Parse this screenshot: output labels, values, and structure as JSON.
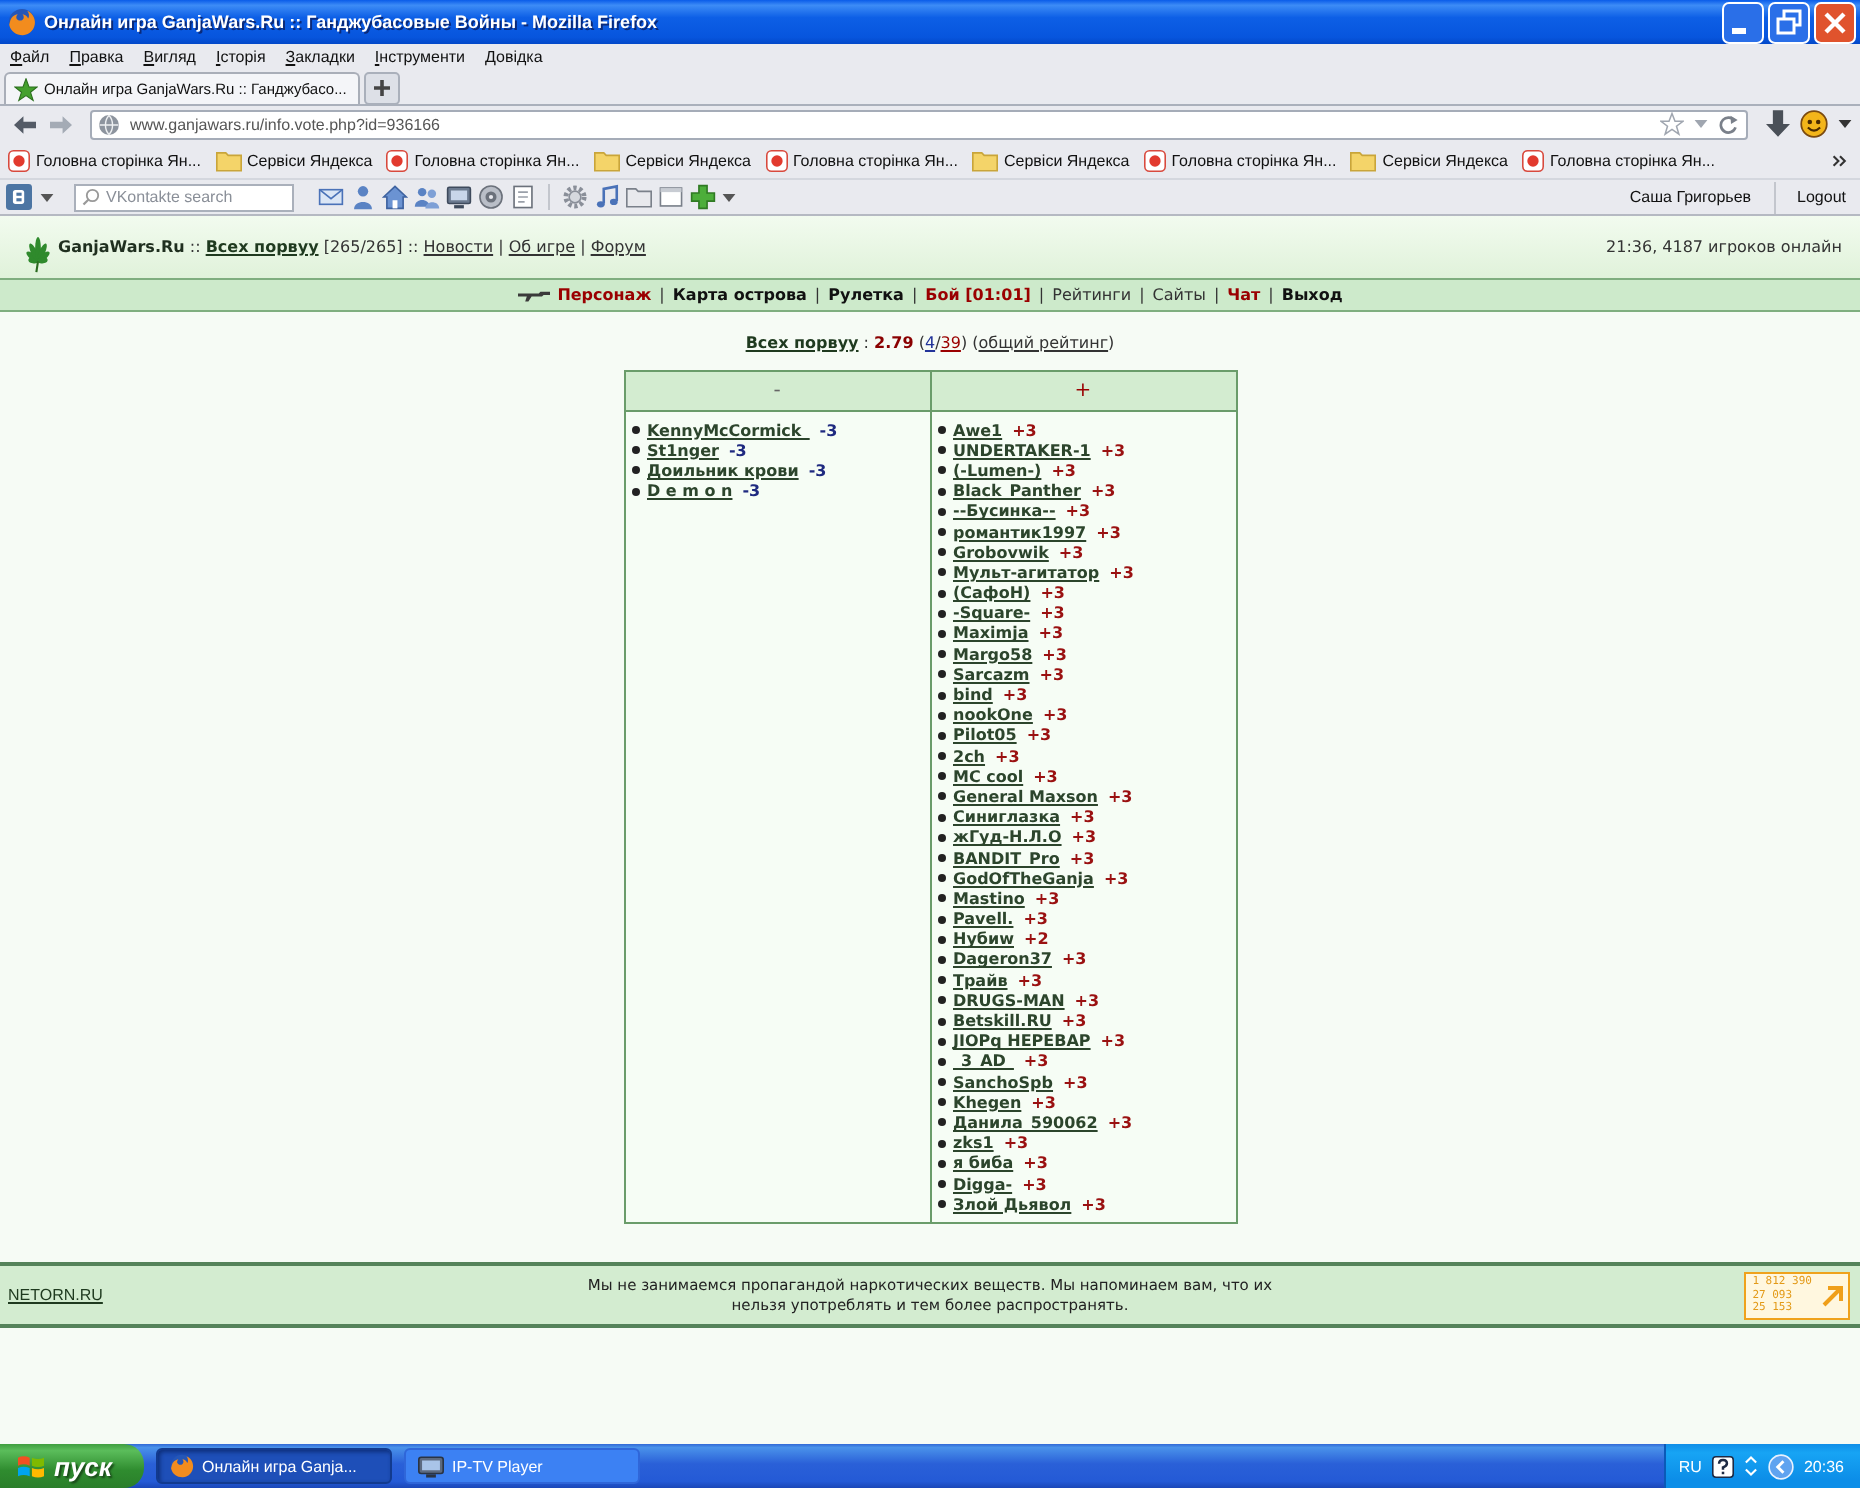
{
  "window": {
    "title": "Онлайн игра GanjaWars.Ru :: Ганджубасовые Войны - Mozilla Firefox"
  },
  "menu_bar": [
    "Файл",
    "Правка",
    "Вигляд",
    "Історія",
    "Закладки",
    "Інструменти",
    "Довідка"
  ],
  "tabs": [
    {
      "label": "Онлайн игра GanjaWars.Ru :: Ганджубасо...",
      "selected": true
    }
  ],
  "address_bar": {
    "url": "www.ganjawars.ru/info.vote.php?id=936166"
  },
  "bookmarks": [
    {
      "kind": "page",
      "label": "Головна сторінка Ян..."
    },
    {
      "kind": "folder",
      "label": "Сервіси Яндекса"
    },
    {
      "kind": "page",
      "label": "Головна сторінка Ян..."
    },
    {
      "kind": "folder",
      "label": "Сервіси Яндекса"
    },
    {
      "kind": "page",
      "label": "Головна сторінка Ян..."
    },
    {
      "kind": "folder",
      "label": "Сервіси Яндекса"
    },
    {
      "kind": "page",
      "label": "Головна сторінка Ян..."
    },
    {
      "kind": "folder",
      "label": "Сервіси Яндекса"
    },
    {
      "kind": "page",
      "label": "Головна сторінка Ян..."
    }
  ],
  "vk_toolbar": {
    "search": {
      "placeholder": "VKontakte search"
    },
    "user": "Саша Григорьев",
    "logout": "Logout"
  },
  "site_header": {
    "parts": [
      {
        "kind": "brand",
        "text": "GanjaWars.Ru"
      },
      {
        "kind": "text",
        "text": " :: "
      },
      {
        "kind": "bold_link",
        "text": "Всех порвуу"
      },
      {
        "kind": "text",
        "text": " [265/265] :: "
      },
      {
        "kind": "link",
        "text": "Новости"
      },
      {
        "kind": "text",
        "text": " | "
      },
      {
        "kind": "link",
        "text": "Об игре"
      },
      {
        "kind": "text",
        "text": " | "
      },
      {
        "kind": "link",
        "text": "Форум"
      }
    ],
    "status": "21:36, 4187 игроков онлайн"
  },
  "game_nav": [
    {
      "kind": "alert",
      "text": "Персонаж"
    },
    {
      "kind": "sep",
      "text": "|"
    },
    {
      "kind": "bold",
      "text": "Карта острова"
    },
    {
      "kind": "sep",
      "text": "|"
    },
    {
      "kind": "bold",
      "text": "Рулетка"
    },
    {
      "kind": "sep",
      "text": "|"
    },
    {
      "kind": "alert",
      "text": "Бой [01:01]"
    },
    {
      "kind": "sep",
      "text": "|"
    },
    {
      "kind": "plain",
      "text": "Рейтинги"
    },
    {
      "kind": "sep",
      "text": "|"
    },
    {
      "kind": "plain",
      "text": "Сайты"
    },
    {
      "kind": "sep",
      "text": "|"
    },
    {
      "kind": "alert",
      "text": "Чат"
    },
    {
      "kind": "sep",
      "text": "|"
    },
    {
      "kind": "bold",
      "text": "Выход"
    }
  ],
  "rating_line": [
    {
      "kind": "title_link",
      "text": "Всех порвуу"
    },
    {
      "kind": "text",
      "text": " : "
    },
    {
      "kind": "score",
      "text": "2.79"
    },
    {
      "kind": "text",
      "text": " ("
    },
    {
      "kind": "for_count",
      "text": "4"
    },
    {
      "kind": "text",
      "text": "/"
    },
    {
      "kind": "total_count",
      "text": "39"
    },
    {
      "kind": "text",
      "text": ") ("
    },
    {
      "kind": "link",
      "text": "общий рейтинг"
    },
    {
      "kind": "text",
      "text": ")"
    }
  ],
  "vote_table": {
    "columns": [
      {
        "kind": "against",
        "label": "-",
        "entries": [
          {
            "name": "KennyMcCormick_",
            "score": "-3"
          },
          {
            "name": "St1nger",
            "score": "-3"
          },
          {
            "name": "Доильник крови",
            "score": "-3"
          },
          {
            "name": "D e m o n",
            "score": "-3"
          }
        ]
      },
      {
        "kind": "for",
        "label": "+",
        "entries": [
          {
            "name": "Awe1",
            "score": "+3"
          },
          {
            "name": "UNDERTAKER-1",
            "score": "+3"
          },
          {
            "name": "(-Lumen-)",
            "score": "+3"
          },
          {
            "name": "Black_Panther",
            "score": "+3"
          },
          {
            "name": "--Бусинка--",
            "score": "+3"
          },
          {
            "name": "романтик1997",
            "score": "+3"
          },
          {
            "name": "Grobovwik",
            "score": "+3"
          },
          {
            "name": "Мульт-агитатор",
            "score": "+3"
          },
          {
            "name": "(СафоН)",
            "score": "+3"
          },
          {
            "name": "-Square-",
            "score": "+3"
          },
          {
            "name": "Maximja",
            "score": "+3"
          },
          {
            "name": "Margo58",
            "score": "+3"
          },
          {
            "name": "Sarcazm",
            "score": "+3"
          },
          {
            "name": "bind",
            "score": "+3"
          },
          {
            "name": "nookOne",
            "score": "+3"
          },
          {
            "name": "Pilot05",
            "score": "+3"
          },
          {
            "name": "2ch",
            "score": "+3"
          },
          {
            "name": "MC cool",
            "score": "+3"
          },
          {
            "name": "General Maxson",
            "score": "+3"
          },
          {
            "name": "Синиглазка",
            "score": "+3"
          },
          {
            "name": "жГуд-Н.Л.О",
            "score": "+3"
          },
          {
            "name": "BANDIT_Pro",
            "score": "+3"
          },
          {
            "name": "GodOfTheGanja",
            "score": "+3"
          },
          {
            "name": "Mastino",
            "score": "+3"
          },
          {
            "name": "Pavell.",
            "score": "+3"
          },
          {
            "name": "Нубиw",
            "score": "+2"
          },
          {
            "name": "Dageron37",
            "score": "+3"
          },
          {
            "name": "Трайв",
            "score": "+3"
          },
          {
            "name": "DRUGS-MAN",
            "score": "+3"
          },
          {
            "name": "Betskill.RU",
            "score": "+3"
          },
          {
            "name": "JIOPq HEPEBAP",
            "score": "+3"
          },
          {
            "name": "_3_AD_",
            "score": "+3"
          },
          {
            "name": "SanchoSpb",
            "score": "+3"
          },
          {
            "name": "Khegen",
            "score": "+3"
          },
          {
            "name": "Данила_590062",
            "score": "+3"
          },
          {
            "name": "zks1",
            "score": "+3"
          },
          {
            "name": "я биба",
            "score": "+3"
          },
          {
            "name": "Digga-",
            "score": "+3"
          },
          {
            "name": "Злой Дьявол",
            "score": "+3"
          }
        ]
      }
    ]
  },
  "footer": {
    "link": "NETORN.RU",
    "notice": "Мы не занимаемся пропагандой наркотических веществ. Мы напоминаем вам, что их нельзя употреблять и тем более распространять.",
    "counter": [
      "1 812 390",
      "27 093",
      "25 153"
    ]
  },
  "taskbar": {
    "start": "пуск",
    "tasks": [
      {
        "kind": "browser",
        "label": "Онлайн игра Ganja...",
        "selected": true
      },
      {
        "kind": "player",
        "label": "IP-TV Player",
        "selected": false
      }
    ],
    "language": "RU",
    "clock": "20:36"
  }
}
